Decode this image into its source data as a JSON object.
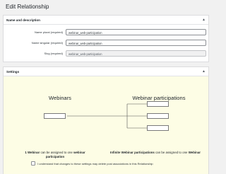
{
  "page": {
    "title": "Edit Relationship"
  },
  "name_panel": {
    "heading": "Name and description",
    "fields": [
      {
        "label": "Name plural (required)",
        "value": "webinar_web-participation"
      },
      {
        "label": "Name singular (required)",
        "value": "webinar_web-participation"
      },
      {
        "label": "Slug (required)",
        "value": "webinar_web-participation"
      }
    ]
  },
  "settings_panel": {
    "heading": "Settings",
    "left_title": "Webinars",
    "right_title": "Webinar participations",
    "left_desc": {
      "count": "1 Webinar",
      "text": " can be assigned to one ",
      "target": "webinar participation"
    },
    "right_desc": {
      "count": "Infinite Webinar participations",
      "text": " can be assigned to one ",
      "target": "Webinar"
    },
    "confirm_label": "I understand that changes to these settings may delete post associations in this Relationship"
  },
  "icons": {
    "collapse": "caret-up-icon"
  }
}
